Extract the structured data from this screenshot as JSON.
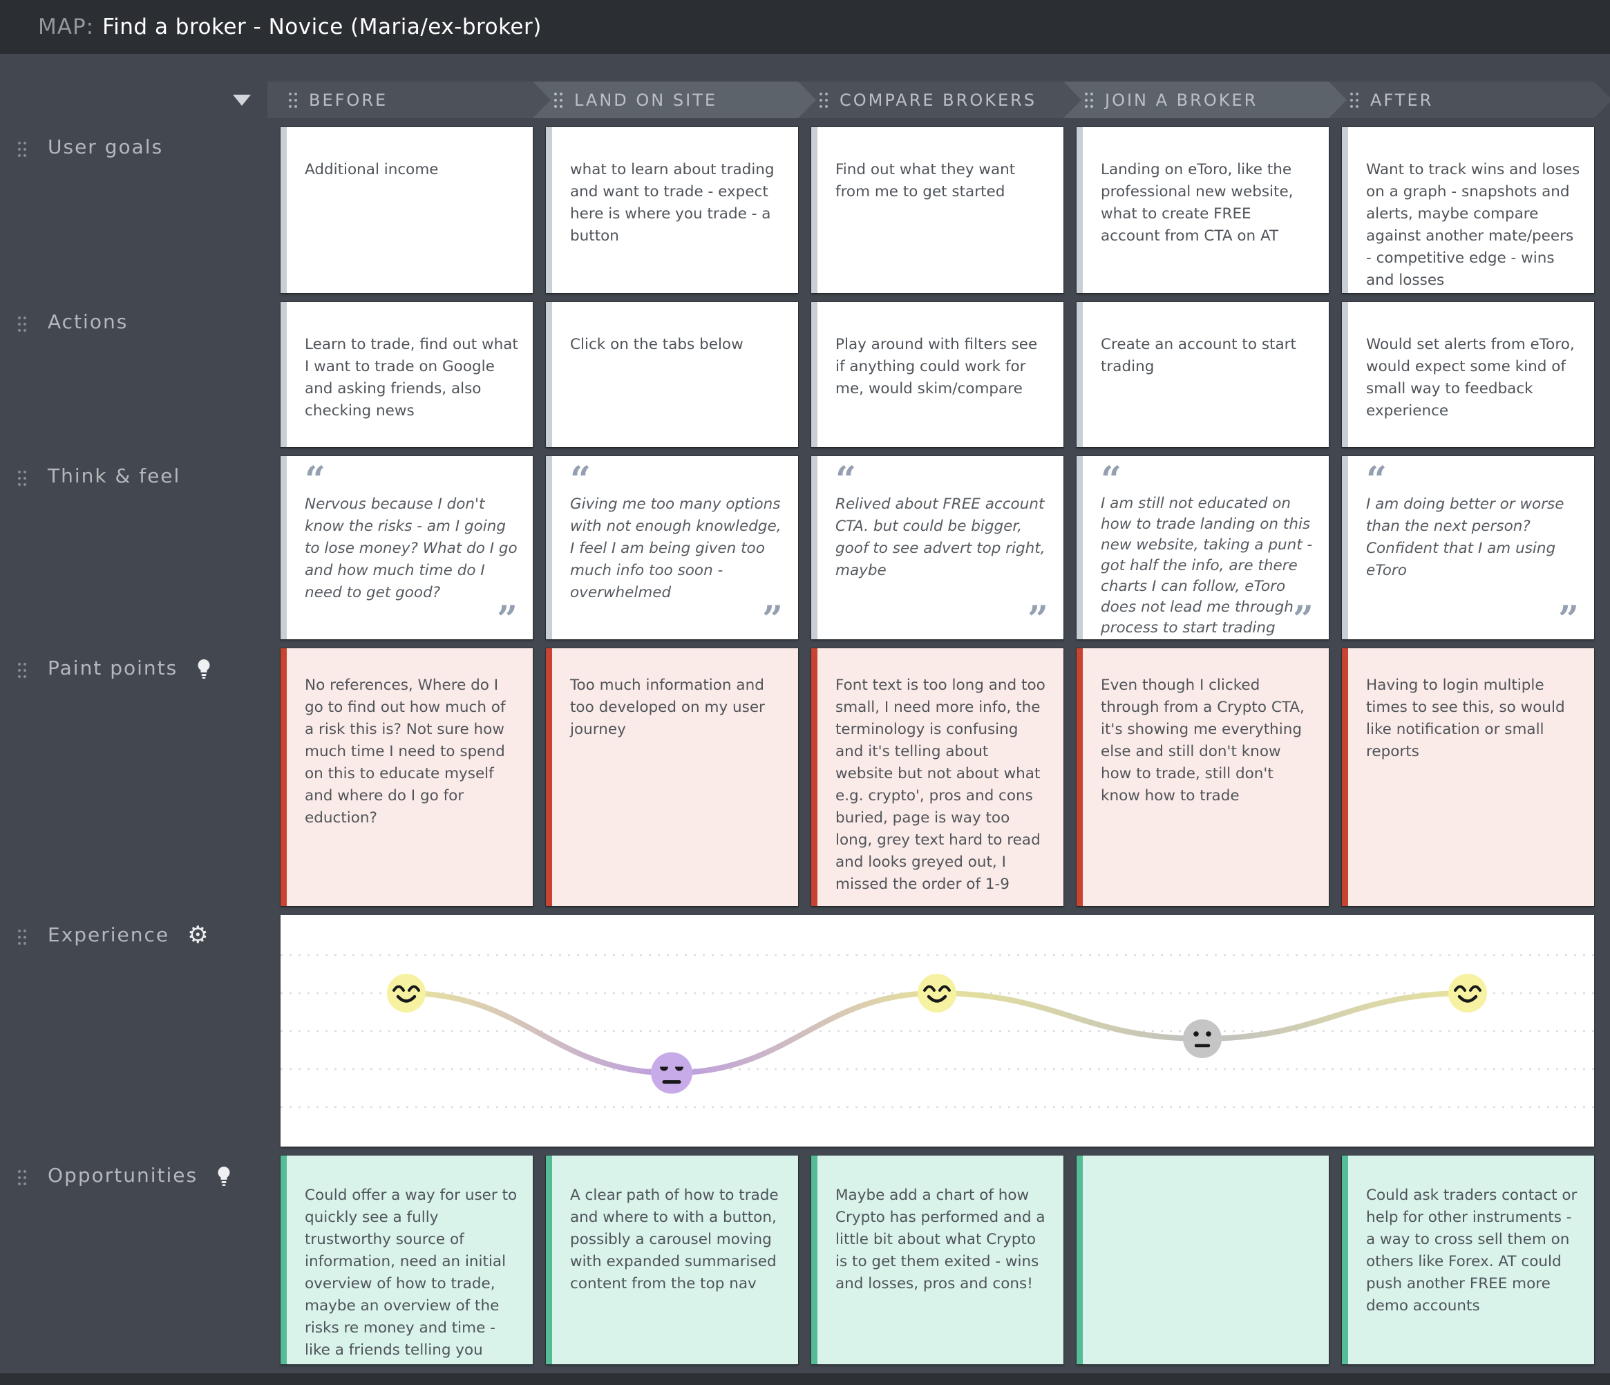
{
  "title_bar": {
    "prefix": "MAP:",
    "title": "Find a broker - Novice (Maria/ex-broker)"
  },
  "stages": [
    {
      "label": "BEFORE"
    },
    {
      "label": "LAND ON SITE"
    },
    {
      "label": "COMPARE BROKERS"
    },
    {
      "label": "JOIN A BROKER"
    },
    {
      "label": "AFTER"
    }
  ],
  "rows": [
    {
      "label": "User goals"
    },
    {
      "label": "Actions"
    },
    {
      "label": "Think & feel"
    },
    {
      "label": "Paint points",
      "icon": "lightbulb"
    },
    {
      "label": "Experience",
      "icon": "gear"
    },
    {
      "label": "Opportunities",
      "icon": "lightbulb"
    }
  ],
  "quotes": {
    "open": "“",
    "close": "”"
  },
  "cells": {
    "user_goals": [
      "Additional income",
      "what to learn about trading and want to trade - expect here is where you trade - a button",
      "Find out what they want from me to get started",
      "Landing on eToro, like the professional new website, what to create FREE account from CTA on AT",
      "Want to track wins and loses on a graph - snapshots and alerts, maybe compare against another mate/peers - competitive edge - wins and losses"
    ],
    "actions": [
      "Learn to trade, find out what I want to trade on Google and asking friends, also checking news",
      "Click on the tabs below",
      "Play around with filters see if anything could work for me, would skim/compare",
      "Create an account to start trading",
      "Would set alerts from eToro, would expect some kind of small way to feedback experience"
    ],
    "think_feel": [
      "Nervous because I don't know the risks - am I going to lose money? What do I go and how much time do I need to get good?",
      "Giving me too many options with not enough knowledge, I feel I am being given too much info too soon - overwhelmed",
      "Relived about FREE account CTA. but could be bigger, goof to see advert top right, maybe",
      "I am still not educated on how to trade landing on this new website, taking a punt - got half the info, are there charts I can follow, eToro does not lead me through process to start trading",
      "I am doing better or worse than the next person?  Confident that I am using eToro"
    ],
    "pain_points": [
      "No references, Where do I go to find out how much of a risk this is? Not sure how much time I need to spend on this to educate myself and where do I go for eduction?",
      "Too much information  and too developed on my user journey",
      "Font text is too long and too small, I need more info, the terminology is confusing and it's telling about website but not about what e.g. crypto', pros and cons buried, page is way too long, grey text hard to read and looks greyed out, I missed the order of 1-9",
      "Even though I clicked through from a Crypto CTA, it's showing me everything else and still don't know how to trade, still don't know how to trade",
      "Having to login multiple times to see this, so would like notification or small reports"
    ],
    "opportunities": [
      "Could offer a way for user to quickly see a fully trustworthy source of information, need an initial overview of how to trade, maybe an overview of the risks re money and time - like a friends telling you",
      "A clear path of how to trade and where to with a button, possibly a carousel moving with expanded summarised content from the top nav",
      "Maybe add a chart of how Crypto has performed and a little bit about what Crypto is to get them exited - wins and losses, pros and cons!",
      "",
      "Could ask traders contact or help for other instruments - a way to cross sell them on others like Forex. AT could push another FREE more demo accounts"
    ]
  },
  "experience_chart": {
    "type": "line",
    "categories": [
      "BEFORE",
      "LAND ON SITE",
      "COMPARE BROKERS",
      "JOIN A BROKER",
      "AFTER"
    ],
    "moods": [
      "happy",
      "annoyed",
      "happy",
      "neutral",
      "happy"
    ],
    "values": [
      4,
      1.9,
      4,
      2.8,
      4
    ],
    "ylim": [
      0,
      5
    ],
    "grid": "dotted",
    "point_colors": [
      "#f6f2a1",
      "#c7abe8",
      "#f6f2a1",
      "#c5c5c5",
      "#f6f2a1"
    ],
    "line_colors": [
      "#e9e49d",
      "#bb9ce2",
      "#e7e29a",
      "#c0c0c0",
      "#e9e49d"
    ]
  },
  "colors": {
    "background": "#434850",
    "titlebar": "#2b2e33",
    "chevron_dark": "#4d525a",
    "chevron_light": "#5d636b",
    "card_strip": "#c9cfd6",
    "pain_accent": "#c84331",
    "pain_bg": "#fbebe8",
    "opportunity_accent": "#54bd97",
    "opportunity_bg": "#d9f2ea",
    "quote_mark": "#94a0b1"
  }
}
